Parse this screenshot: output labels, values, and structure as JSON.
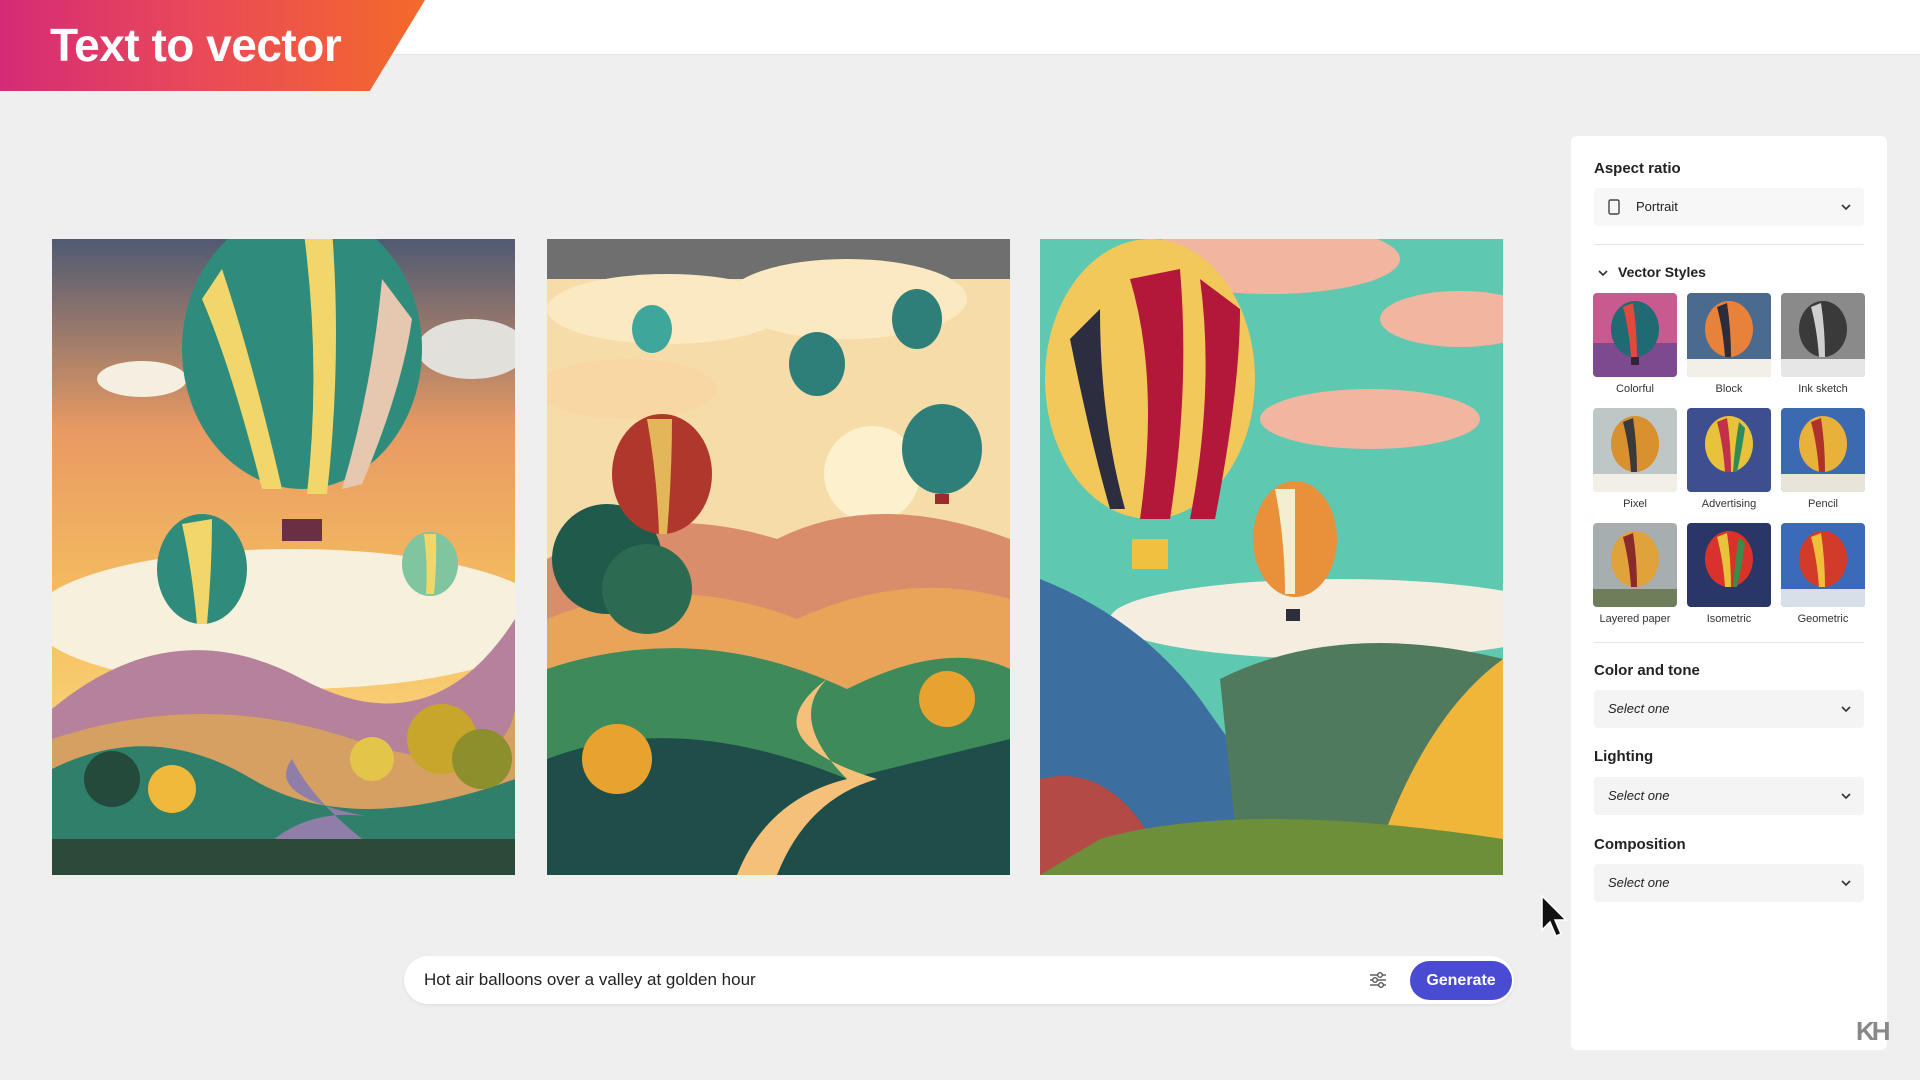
{
  "header": {
    "title": "Text to vector"
  },
  "prompt": {
    "value": "Hot air balloons over a valley at golden hour",
    "generate_label": "Generate"
  },
  "panel": {
    "aspect_ratio": {
      "label": "Aspect ratio",
      "value": "Portrait"
    },
    "vector_styles": {
      "label": "Vector Styles",
      "styles": [
        {
          "label": "Colorful"
        },
        {
          "label": "Block"
        },
        {
          "label": "Ink sketch"
        },
        {
          "label": "Pixel"
        },
        {
          "label": "Advertising"
        },
        {
          "label": "Pencil"
        },
        {
          "label": "Layered paper"
        },
        {
          "label": "Isometric"
        },
        {
          "label": "Geometric"
        }
      ]
    },
    "color_and_tone": {
      "label": "Color and tone",
      "value": "Select one"
    },
    "lighting": {
      "label": "Lighting",
      "value": "Select one"
    },
    "composition": {
      "label": "Composition",
      "value": "Select one"
    }
  },
  "watermark": "KH"
}
